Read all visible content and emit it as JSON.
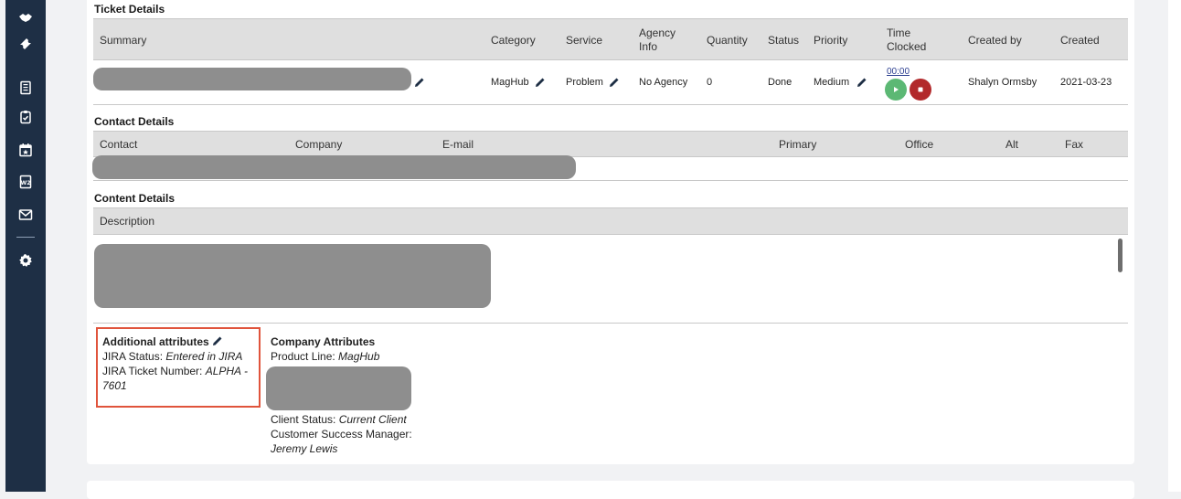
{
  "ticket_details": {
    "title": "Ticket Details",
    "headers": {
      "summary": "Summary",
      "category": "Category",
      "service": "Service",
      "agency_line1": "Agency",
      "agency_line2": "Info",
      "quantity": "Quantity",
      "status": "Status",
      "priority": "Priority",
      "time_line1": "Time",
      "time_line2": "Clocked",
      "created_by": "Created by",
      "created": "Created"
    },
    "row": {
      "category": "MagHub",
      "service": "Problem",
      "agency_info": "No Agency",
      "quantity": "0",
      "status": "Done",
      "priority": "Medium",
      "time_clocked": "00:00",
      "created_by": "Shalyn Ormsby",
      "created": "2021-03-23"
    }
  },
  "contact_details": {
    "title": "Contact Details",
    "headers": {
      "contact": "Contact",
      "company": "Company",
      "email": "E-mail",
      "primary": "Primary",
      "office": "Office",
      "alt": "Alt",
      "fax": "Fax"
    }
  },
  "content_details": {
    "title": "Content Details",
    "description_header": "Description"
  },
  "additional_attributes": {
    "title": "Additional attributes",
    "jira_status_label": "JIRA Status: ",
    "jira_status_value": "Entered in JIRA",
    "jira_ticket_label": "JIRA Ticket Number: ",
    "jira_ticket_value_line1": "ALPHA -",
    "jira_ticket_value_line2": "7601"
  },
  "company_attributes": {
    "title": "Company Attributes",
    "product_line_label": "Product Line: ",
    "product_line_value": "MagHub",
    "client_status_label": "Client Status: ",
    "client_status_value": "Current Client",
    "csm_label": "Customer Success Manager:",
    "csm_value": "Jeremy Lewis"
  },
  "sidebar": {
    "icons": [
      "handshake-icon",
      "ticket-icon",
      "invoice-icon",
      "clipboard-check-icon",
      "calendar-star-icon",
      "w2-form-icon",
      "mail-icon",
      "gear-icon"
    ]
  },
  "colors": {
    "sidebar_bg": "#1e2f45",
    "play_green": "#5cb874",
    "stop_red": "#b2292b",
    "highlight_border": "#e0543c"
  }
}
